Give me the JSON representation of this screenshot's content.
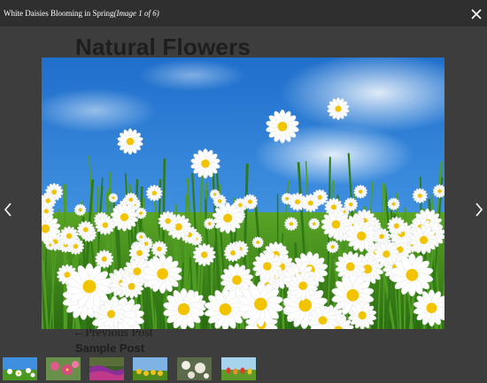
{
  "background_page": {
    "title": "Natural Flowers",
    "previous_post": "←Previous Post",
    "post_title": "Sample Post"
  },
  "lightbox": {
    "caption_title": "White Daisies Blooming in Spring",
    "caption_counter": "(Image 1 of 6)",
    "close_icon": "close-icon",
    "prev_icon": "chevron-left-icon",
    "next_icon": "chevron-right-icon",
    "thumbnails_count_shown": 6
  },
  "colors": {
    "overlay": "#3d3d3d",
    "topbar": "#2f2f2f",
    "sky": "#2f7fd6",
    "grass": "#3f8a1c",
    "petal": "#ffffff",
    "center": "#f2c400"
  }
}
